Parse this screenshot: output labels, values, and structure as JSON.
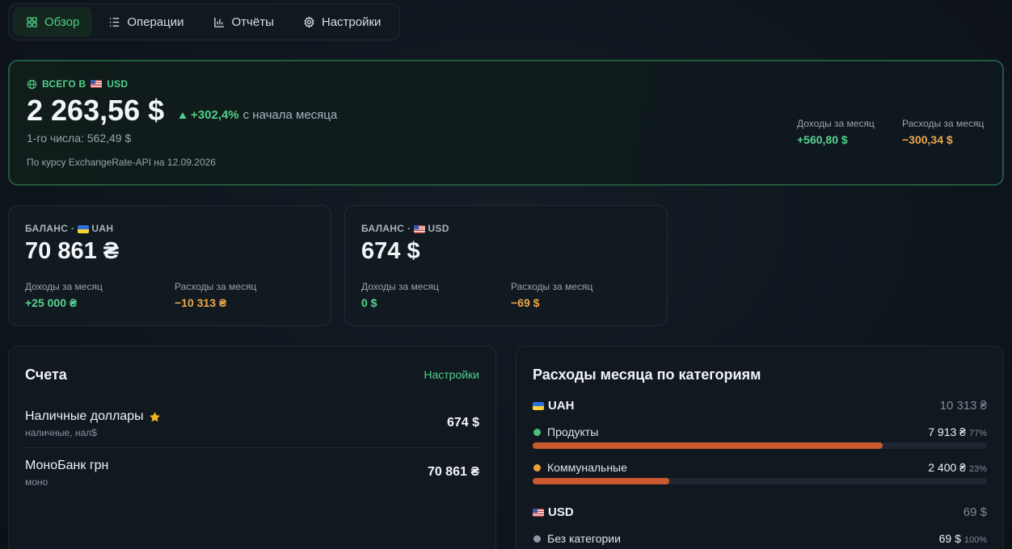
{
  "nav": {
    "tabs": [
      {
        "label": "Обзор",
        "icon": "grid-icon",
        "active": true
      },
      {
        "label": "Операции",
        "icon": "list-icon",
        "active": false
      },
      {
        "label": "Отчёты",
        "icon": "bar-chart-icon",
        "active": false
      },
      {
        "label": "Настройки",
        "icon": "gear-icon",
        "active": false
      }
    ]
  },
  "total": {
    "label_prefix": "ВСЕГО В",
    "currency": "USD",
    "amount": "2 263,56 $",
    "change_pct": "+302,4%",
    "change_text": "с начала месяца",
    "first_day": "1-го числа: 562,49 $",
    "rate_note": "По курсу ExchangeRate-API на 12.09.2026",
    "income_label": "Доходы за месяц",
    "income_value": "+560,80 $",
    "expense_label": "Расходы за месяц",
    "expense_value": "−300,34 $"
  },
  "balances": [
    {
      "label_prefix": "БАЛАНС ·",
      "currency": "UAH",
      "amount": "70 861 ₴",
      "income_label": "Доходы за месяц",
      "income_value": "+25 000 ₴",
      "expense_label": "Расходы за месяц",
      "expense_value": "−10 313 ₴"
    },
    {
      "label_prefix": "БАЛАНС ·",
      "currency": "USD",
      "amount": "674 $",
      "income_label": "Доходы за месяц",
      "income_value": "0 $",
      "expense_label": "Расходы за месяц",
      "expense_value": "−69 $"
    }
  ],
  "accounts": {
    "title": "Счета",
    "settings_link": "Настройки",
    "items": [
      {
        "name": "Наличные доллары",
        "subtitle": "наличные, нал$",
        "value": "674 $",
        "starred": true
      },
      {
        "name": "МоноБанк грн",
        "subtitle": "моно",
        "value": "70 861 ₴",
        "starred": false
      }
    ]
  },
  "expenses": {
    "title": "Расходы месяца по категориям",
    "groups": [
      {
        "currency": "UAH",
        "total": "10 313 ₴",
        "categories": [
          {
            "name": "Продукты",
            "value": "7 913 ₴",
            "pct_label": "77%",
            "fraction": 0.77,
            "color": "#4cbf7b"
          },
          {
            "name": "Коммунальные",
            "value": "2 400 ₴",
            "pct_label": "23%",
            "fraction": 0.3,
            "color": "#e8a23a"
          }
        ]
      },
      {
        "currency": "USD",
        "total": "69 $",
        "categories": [
          {
            "name": "Без категории",
            "value": "69 $",
            "pct_label": "100%",
            "fraction": 1.0,
            "color": "#8d99a6"
          }
        ]
      }
    ]
  },
  "colors": {
    "accent_green": "#4fd08a",
    "income_green": "#58d391",
    "expense_orange": "#f0a64b",
    "bar_fill": "#c9592f"
  }
}
